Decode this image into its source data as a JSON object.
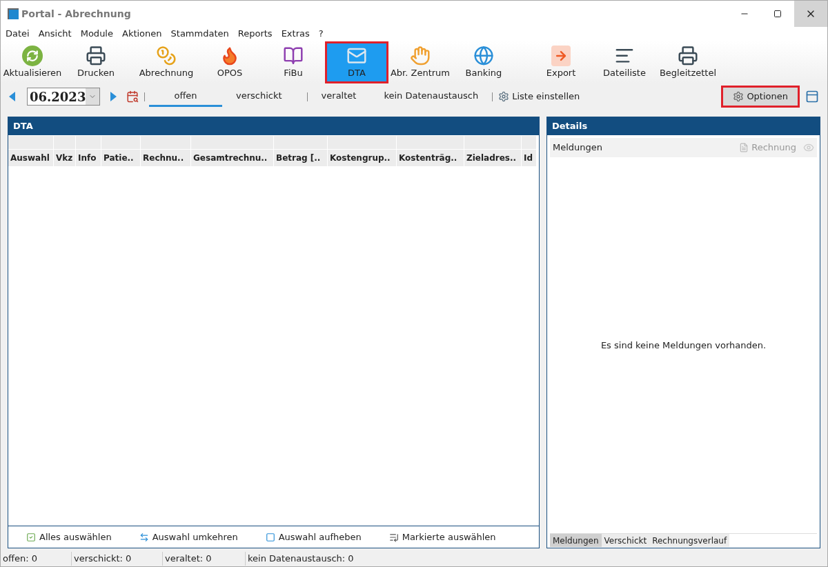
{
  "window": {
    "title": "Portal - Abrechnung"
  },
  "menu": [
    "Datei",
    "Ansicht",
    "Module",
    "Aktionen",
    "Stammdaten",
    "Reports",
    "Extras",
    "?"
  ],
  "toolbar": [
    {
      "label": "Aktualisieren",
      "kind": "refresh",
      "selected": false,
      "highlighted": false
    },
    {
      "label": "Drucken",
      "kind": "printer",
      "selected": false,
      "highlighted": false
    },
    {
      "label": "Abrechnung",
      "kind": "coins",
      "selected": false,
      "highlighted": false
    },
    {
      "label": "OPOS",
      "kind": "flame",
      "selected": false,
      "highlighted": false
    },
    {
      "label": "FiBu",
      "kind": "books",
      "selected": false,
      "highlighted": false
    },
    {
      "label": "DTA",
      "kind": "mail",
      "selected": true,
      "highlighted": true
    },
    {
      "label": "Abr. Zentrum",
      "kind": "hand",
      "selected": false,
      "highlighted": false
    },
    {
      "label": "Banking",
      "kind": "globe",
      "selected": false,
      "highlighted": false
    },
    {
      "label": "Export",
      "kind": "export",
      "selected": false,
      "highlighted": false
    },
    {
      "label": "Dateiliste",
      "kind": "list",
      "selected": false,
      "highlighted": false
    },
    {
      "label": "Begleitzettel",
      "kind": "printer",
      "selected": false,
      "highlighted": false
    }
  ],
  "period": {
    "value": "06.2023"
  },
  "filter_tabs": [
    {
      "label": "offen",
      "selected": true
    },
    {
      "label": "verschickt",
      "selected": false
    },
    {
      "label": "veraltet",
      "selected": false
    },
    {
      "label": "kein Datenaustausch",
      "selected": false
    }
  ],
  "list_settings": "Liste einstellen",
  "options_button": {
    "label": "Optionen",
    "highlighted": true
  },
  "dta_panel": {
    "title": "DTA",
    "columns": [
      "Auswahl",
      "Vkz",
      "Info",
      "Patie..",
      "Rechnu..",
      "Gesamtrechnu..",
      "Betrag [..",
      "Kostengrup..",
      "Kostenträg..",
      "Zieladres..",
      "Id"
    ],
    "actions": [
      {
        "label": "Alles auswählen",
        "kind": "check"
      },
      {
        "label": "Auswahl umkehren",
        "kind": "swap"
      },
      {
        "label": "Auswahl aufheben",
        "kind": "uncheck"
      },
      {
        "label": "Markierte auswählen",
        "kind": "marked"
      }
    ]
  },
  "details_panel": {
    "title": "Details",
    "header": "Meldungen",
    "invoice_button": "Rechnung",
    "empty_message": "Es sind keine Meldungen vorhanden.",
    "tabs": [
      {
        "label": "Meldungen",
        "selected": true
      },
      {
        "label": "Verschickt",
        "selected": false
      },
      {
        "label": "Rechnungsverlauf",
        "selected": false
      }
    ]
  },
  "status_bar": [
    "offen: 0",
    "verschickt: 0",
    "veraltet: 0",
    "kein Datenaustausch: 0"
  ]
}
